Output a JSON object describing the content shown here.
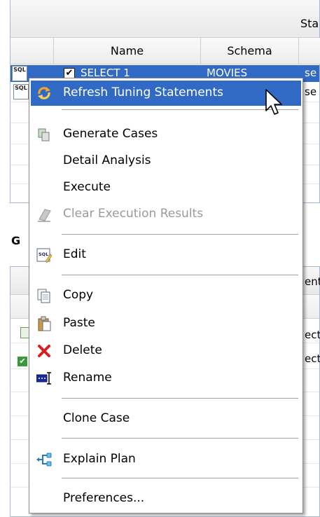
{
  "top_table": {
    "group_header": "Sta",
    "columns": [
      "Name",
      "Schema"
    ],
    "selected_row": {
      "icon": "sql-icon",
      "name": "SELECT 1",
      "schema": "MOVIES",
      "statement": "se"
    },
    "second_row": {
      "icon": "sql-icon",
      "statement": "se"
    }
  },
  "mid_label": "G",
  "bottom_table": {
    "header_fragment": "ent",
    "rows": [
      {
        "text": "ect"
      },
      {
        "text": "ect"
      }
    ]
  },
  "context_menu": {
    "items": [
      {
        "label": "Refresh Tuning Statements",
        "icon": "refresh-icon",
        "state": "hover"
      },
      {
        "label": "Generate Cases",
        "icon": "generate-cases-icon",
        "state": "normal"
      },
      {
        "label": "Detail Analysis",
        "icon": "",
        "state": "normal"
      },
      {
        "label": "Execute",
        "icon": "",
        "state": "normal"
      },
      {
        "label": "Clear Execution Results",
        "icon": "eraser-icon",
        "state": "disabled"
      },
      {
        "label": "Edit",
        "icon": "sql-edit-icon",
        "state": "normal"
      },
      {
        "label": "Copy",
        "icon": "copy-icon",
        "state": "normal"
      },
      {
        "label": "Paste",
        "icon": "paste-icon",
        "state": "normal"
      },
      {
        "label": "Delete",
        "icon": "delete-icon",
        "state": "normal"
      },
      {
        "label": "Rename",
        "icon": "rename-icon",
        "state": "normal"
      },
      {
        "label": "Clone Case",
        "icon": "",
        "state": "normal"
      },
      {
        "label": "Explain Plan",
        "icon": "explain-plan-icon",
        "state": "normal"
      },
      {
        "label": "Preferences...",
        "icon": "",
        "state": "normal"
      }
    ]
  },
  "colors": {
    "selection": "#316ac5",
    "disabled_text": "#9a9a9a",
    "menu_border": "#8a8a8a",
    "delete_red": "#d42020"
  }
}
